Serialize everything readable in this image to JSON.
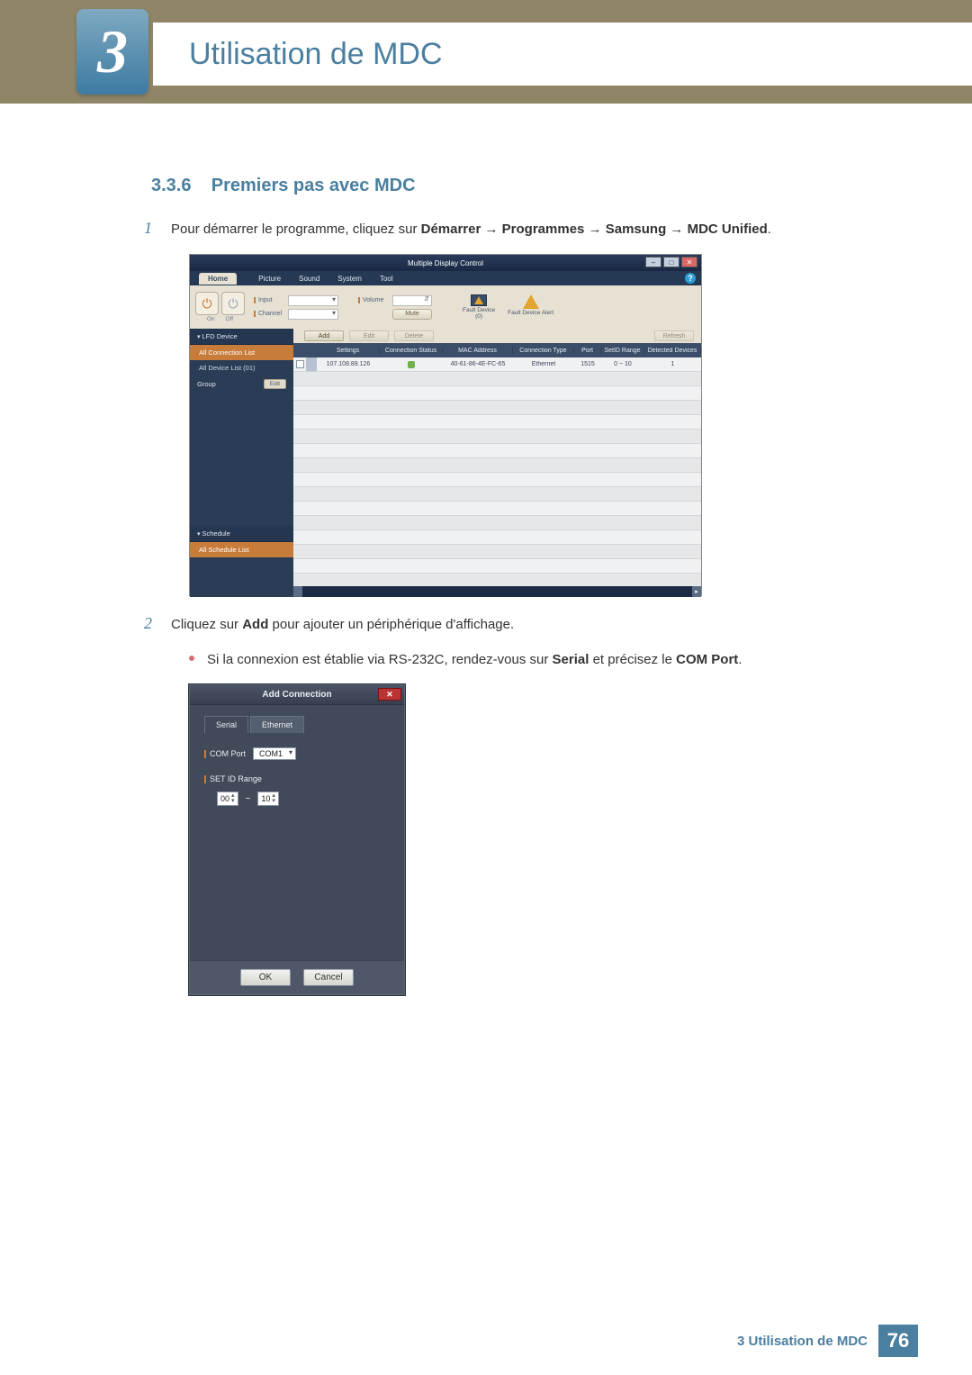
{
  "header": {
    "chapter_number": "3",
    "chapter_title": "Utilisation de MDC"
  },
  "section": {
    "number": "3.3.6",
    "title": "Premiers pas avec MDC"
  },
  "steps": {
    "s1_num": "1",
    "s1_a": "Pour démarrer le programme, cliquez sur ",
    "s1_b": "Démarrer",
    "s1_arrow": " → ",
    "s1_c": "Programmes",
    "s1_d": "Samsung",
    "s1_e": "MDC Unified",
    "s1_f": ".",
    "s2_num": "2",
    "s2_a": "Cliquez sur ",
    "s2_b": "Add",
    "s2_c": " pour ajouter un périphérique d'affichage.",
    "bullet_a": "Si la connexion est établie via RS-232C, rendez-vous sur ",
    "bullet_b": "Serial",
    "bullet_c": " et précisez le ",
    "bullet_d": "COM Port",
    "bullet_e": "."
  },
  "mdc": {
    "titlebar": "Multiple Display Control",
    "menu": {
      "home": "Home",
      "picture": "Picture",
      "sound": "Sound",
      "system": "System",
      "tool": "Tool"
    },
    "toolbar": {
      "on": "On",
      "off": "Off",
      "input_lbl": "Input",
      "channel_lbl": "Channel",
      "volume_lbl": "Volume",
      "mute": "Mute",
      "fault0": "Fault Device",
      "faultcount": "(0)",
      "alert": "Fault Device Alert"
    },
    "sidebar": {
      "lfd": "LFD Device",
      "all_conn": "All Connection List",
      "all_dev": "All Device List (01)",
      "group": "Group",
      "edit": "Edit",
      "schedule": "Schedule",
      "all_sched": "All Schedule List"
    },
    "actions": {
      "add": "Add",
      "edit": "Edit",
      "delete": "Delete",
      "refresh": "Refresh"
    },
    "headers": {
      "settings": "Settings",
      "status": "Connection Status",
      "mac": "MAC Address",
      "type": "Connection Type",
      "port": "Port",
      "range": "SetID Range",
      "detected": "Detected Devices"
    },
    "row": {
      "settings": "107.108.89.126",
      "mac": "40-61-86-4E-FC-65",
      "type": "Ethernet",
      "port": "1515",
      "range": "0 ~ 10",
      "detected": "1"
    }
  },
  "dialog": {
    "title": "Add Connection",
    "tabs": {
      "serial": "Serial",
      "ethernet": "Ethernet"
    },
    "com_lbl": "COM Port",
    "com_val": "COM1",
    "range_lbl": "SET ID Range",
    "range_from": "00",
    "range_sep": "~",
    "range_to": "10",
    "ok": "OK",
    "cancel": "Cancel"
  },
  "footer": {
    "text": "3 Utilisation de MDC",
    "page": "76"
  }
}
